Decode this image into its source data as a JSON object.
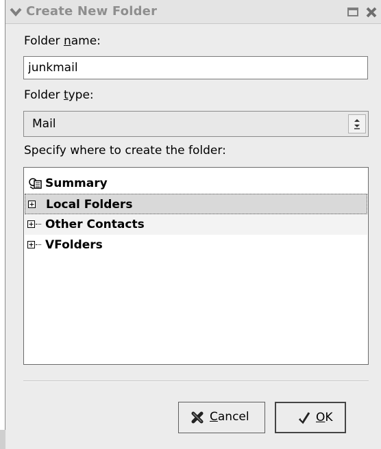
{
  "titlebar": {
    "title": "Create New Folder",
    "menu_icon": "chevron-down-icon",
    "maximize_icon": "maximize-icon",
    "close_icon": "close-icon"
  },
  "folder_name": {
    "label_pre": "Folder ",
    "label_mnemonic": "n",
    "label_post": "ame:",
    "value": "junkmail"
  },
  "folder_type": {
    "label_pre": "Folder ",
    "label_mnemonic": "t",
    "label_post": "ype:",
    "selected": "Mail"
  },
  "location": {
    "label": "Specify where to create the folder:"
  },
  "tree": {
    "items": [
      {
        "label": "Summary",
        "icon": "summary-icon",
        "expander": false
      },
      {
        "label": "Local Folders",
        "expander": true,
        "selected": true
      },
      {
        "label": "Other Contacts",
        "expander": true
      },
      {
        "label": "VFolders",
        "expander": true
      }
    ]
  },
  "buttons": {
    "cancel_mnemonic": "C",
    "cancel_rest": "ancel",
    "cancel_icon": "cancel-icon",
    "ok_mnemonic": "O",
    "ok_rest": "K",
    "ok_icon": "ok-icon"
  },
  "colors": {
    "window_bg": "#ececec",
    "title_text": "#8e8e8e",
    "selected_row": "#d9d9d9",
    "alt_row": "#f3f3f3"
  }
}
